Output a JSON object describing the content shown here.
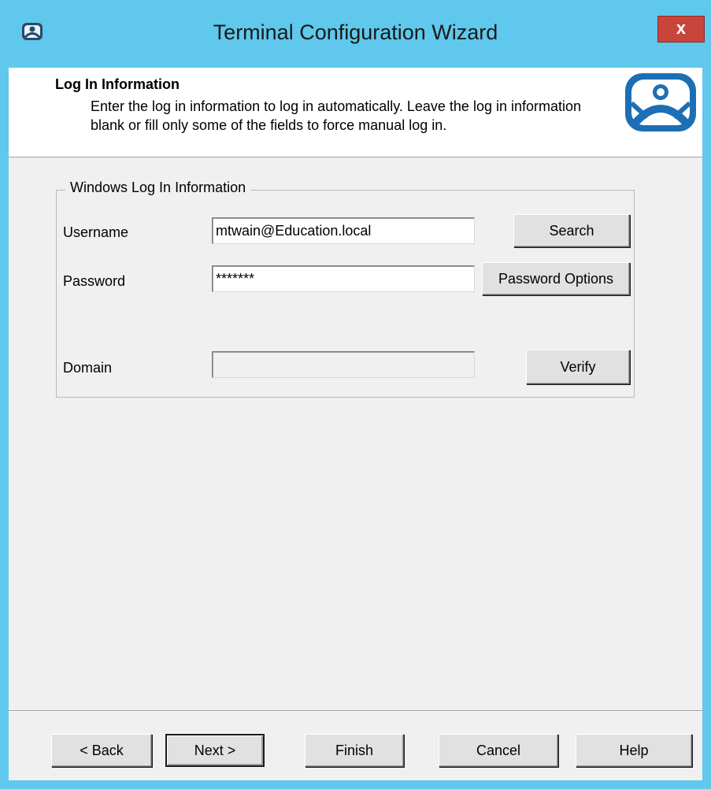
{
  "window": {
    "title": "Terminal Configuration Wizard",
    "close_label": "x"
  },
  "header": {
    "title": "Log In Information",
    "description": "Enter the log in information to log in automatically. Leave the log in information blank or fill only some of the fields to force manual log in."
  },
  "group": {
    "legend": "Windows Log In Information",
    "username": {
      "label": "Username",
      "value": "mtwain@Education.local"
    },
    "password": {
      "label": "Password",
      "value": "*******"
    },
    "domain": {
      "label": "Domain",
      "value": ""
    },
    "search_label": "Search",
    "password_options_label": "Password Options",
    "verify_label": "Verify"
  },
  "footer": {
    "back_label": "< Back",
    "next_label": "Next >",
    "finish_label": "Finish",
    "cancel_label": "Cancel",
    "help_label": "Help"
  },
  "colors": {
    "title_bar": "#5fc8ec",
    "close_button": "#c7453b",
    "logo": "#1c6fb5"
  },
  "icons": {
    "app": "terminal-user-icon",
    "logo": "thinmanager-logo-icon"
  }
}
